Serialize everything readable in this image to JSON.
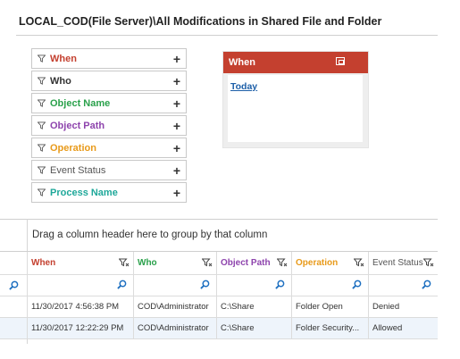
{
  "page": {
    "title": "LOCAL_COD(File Server)\\All Modifications in Shared File and Folder"
  },
  "filters": [
    {
      "label": "When",
      "color": "#c4402f"
    },
    {
      "label": "Who",
      "color": "#333333"
    },
    {
      "label": "Object Name",
      "color": "#2aa14b"
    },
    {
      "label": "Object Path",
      "color": "#8e44ad"
    },
    {
      "label": "Operation",
      "color": "#e89a1a"
    },
    {
      "label": "Event Status",
      "color": "#555555"
    },
    {
      "label": "Process Name",
      "color": "#1fa89a"
    }
  ],
  "filter_add_symbol": "+",
  "when_panel": {
    "title": "When",
    "value": "Today",
    "header_color": "#c4402f"
  },
  "grid": {
    "group_hint": "Drag a column header here to group by that column",
    "columns": [
      {
        "label": "When",
        "color": "#c4402f"
      },
      {
        "label": "Who",
        "color": "#2aa14b"
      },
      {
        "label": "Object Path",
        "color": "#8e44ad"
      },
      {
        "label": "Operation",
        "color": "#e89a1a"
      },
      {
        "label": "Event Status",
        "color": "#555555"
      }
    ],
    "rows": [
      {
        "when": "11/30/2017 4:56:38 PM",
        "who": "COD\\Administrator",
        "object_path": "C:\\Share",
        "operation": "Folder Open",
        "event_status": "Denied"
      },
      {
        "when": "11/30/2017 12:22:29 PM",
        "who": "COD\\Administrator",
        "object_path": "C:\\Share",
        "operation": "Folder Security...",
        "event_status": "Allowed"
      }
    ]
  },
  "icons": {
    "filter": "funnel-icon",
    "add": "plus-icon",
    "search": "magnifier-icon",
    "pin": "pin-icon",
    "column_filter": "column-filter-icon"
  }
}
